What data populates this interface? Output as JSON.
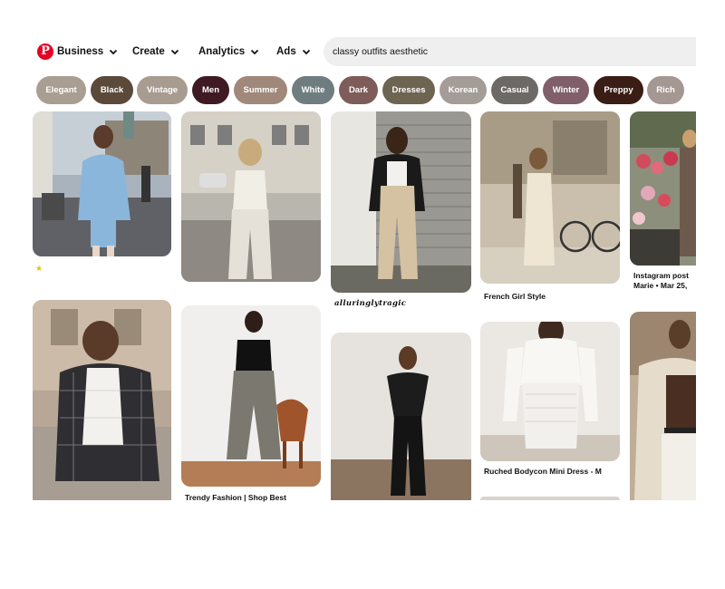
{
  "nav": {
    "logo_letter": "P",
    "business": "Business",
    "create": "Create",
    "analytics": "Analytics",
    "ads": "Ads"
  },
  "search": {
    "value": "classy outfits aesthetic"
  },
  "chips": [
    {
      "label": "Elegant",
      "color": "#a89e91"
    },
    {
      "label": "Black",
      "color": "#5b4a3a"
    },
    {
      "label": "Vintage",
      "color": "#a89c90"
    },
    {
      "label": "Men",
      "color": "#3f1a22"
    },
    {
      "label": "Summer",
      "color": "#a0887a"
    },
    {
      "label": "White",
      "color": "#6f7d80"
    },
    {
      "label": "Dark",
      "color": "#7e5c5a"
    },
    {
      "label": "Dresses",
      "color": "#6e6452"
    },
    {
      "label": "Korean",
      "color": "#a39c97"
    },
    {
      "label": "Casual",
      "color": "#6d6a66"
    },
    {
      "label": "Winter",
      "color": "#805f6a"
    },
    {
      "label": "Preppy",
      "color": "#3a1d14"
    },
    {
      "label": "Rich",
      "color": "#a59892"
    }
  ],
  "pins": {
    "col1_top": {
      "caption": "",
      "badge": "★"
    },
    "col2_bottom": {
      "caption": "Trendy Fashion | Shop Best"
    },
    "col3_top": {
      "caption": "alluringlytragic"
    },
    "col4_top": {
      "caption": "French Girl Style"
    },
    "col4_bottom": {
      "caption": "Ruched Bodycon Mini Dress - M"
    },
    "col5_top": {
      "caption": "Instagram post",
      "sub": "Marie • Mar 25,"
    }
  },
  "colors": {
    "pinterest_red": "#e60023",
    "search_bg": "#efefef"
  }
}
